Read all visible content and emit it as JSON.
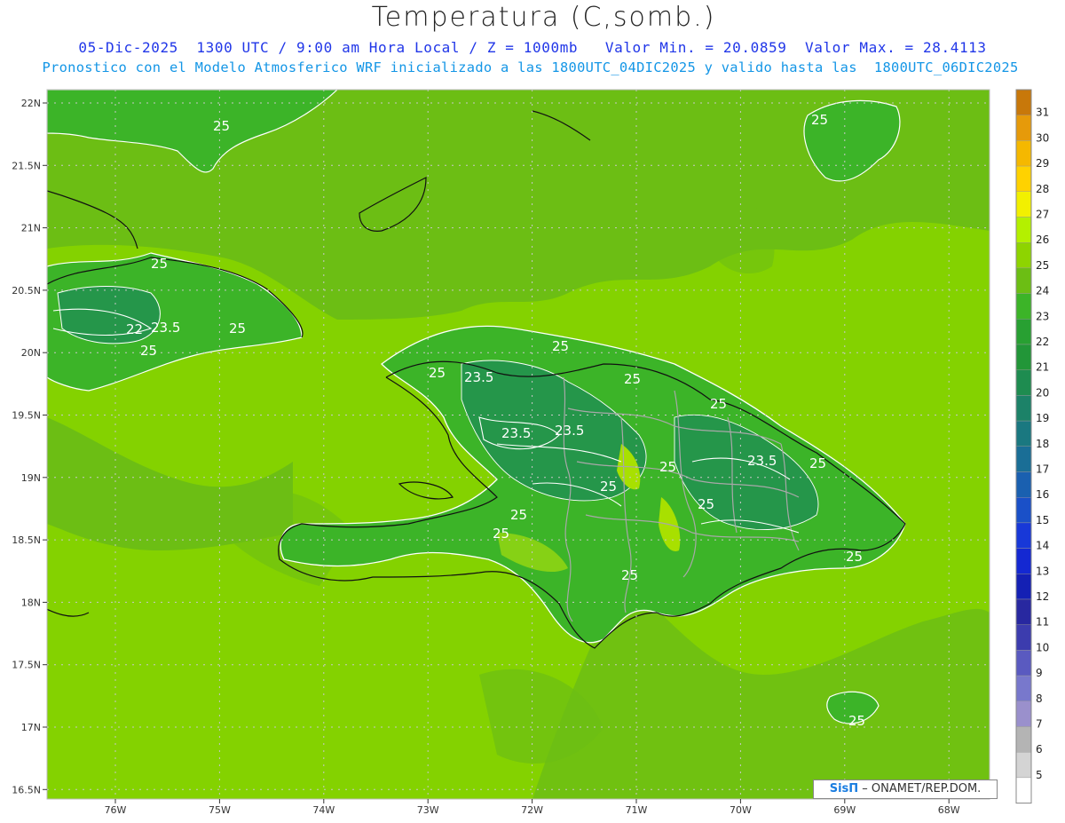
{
  "title": "Temperatura (C,somb.)",
  "subtitle_line1": "05-Dic-2025  1300 UTC / 9:00 am Hora Local / Z = 1000mb   Valor Min. = 20.0859  Valor Max. = 28.4113",
  "subtitle_line2": "Pronostico con el Modelo Atmosferico WRF inicializado a las 1800UTC_04DIC2025 y valido hasta las  1800UTC_06DIC2025",
  "credit": {
    "logo": "SisΠ",
    "text": " – ONAMET/REP.DOM."
  },
  "lat_labels": [
    "22N",
    "21.5N",
    "21N",
    "20.5N",
    "20N",
    "19.5N",
    "19N",
    "18.5N",
    "18N",
    "17.5N",
    "17N",
    "16.5N"
  ],
  "lon_labels": [
    "76W",
    "75W",
    "74W",
    "73W",
    "72W",
    "71W",
    "70W",
    "69W",
    "68W"
  ],
  "colorbar": {
    "levels": [
      "31",
      "30",
      "29",
      "28",
      "27",
      "26",
      "25",
      "24",
      "23",
      "22",
      "21",
      "20",
      "19",
      "18",
      "17",
      "16",
      "15",
      "14",
      "13",
      "12",
      "11",
      "10",
      "9",
      "8",
      "7",
      "6",
      "5"
    ],
    "colors": [
      "#c8780a",
      "#e69a0a",
      "#f5b800",
      "#ffd200",
      "#f2f000",
      "#b4f000",
      "#8ed400",
      "#6cbe14",
      "#3cb428",
      "#28a032",
      "#229638",
      "#1e8c50",
      "#1c8268",
      "#1a7880",
      "#1a6e96",
      "#1a60b0",
      "#1a50c8",
      "#1838d8",
      "#1428d2",
      "#1420b4",
      "#2828a0",
      "#3c3cae",
      "#5a5ac0",
      "#7878cc",
      "#9a90cc",
      "#b4b4b4",
      "#d4d4d4",
      "#ffffff"
    ]
  },
  "contour_labels": [
    {
      "text": "25"
    },
    {
      "text": "25"
    },
    {
      "text": "23.5"
    },
    {
      "text": "22"
    },
    {
      "text": "25"
    },
    {
      "text": "25"
    },
    {
      "text": "25"
    },
    {
      "text": "25"
    },
    {
      "text": "23.5"
    },
    {
      "text": "25"
    },
    {
      "text": "23.5"
    },
    {
      "text": "23.5"
    },
    {
      "text": "25"
    },
    {
      "text": "25"
    },
    {
      "text": "25"
    },
    {
      "text": "23.5"
    },
    {
      "text": "25"
    },
    {
      "text": "25"
    },
    {
      "text": "25"
    },
    {
      "text": "25"
    },
    {
      "text": "25"
    },
    {
      "text": "25"
    },
    {
      "text": "25"
    },
    {
      "text": "25"
    }
  ],
  "colors": {
    "sea": "#84d200",
    "sea_dark": "#6cbe14",
    "land_25": "#3cb428",
    "land_24": "#2da43a",
    "land_23": "#25964a",
    "highland": "#a8e000",
    "subtitle1": "#2036e8",
    "subtitle2": "#1496e6"
  }
}
